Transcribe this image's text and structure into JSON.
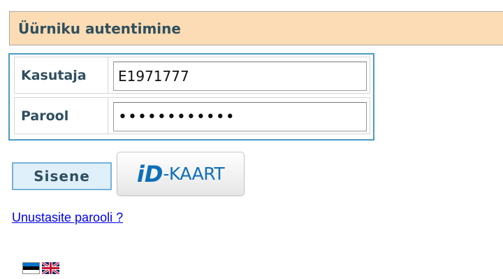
{
  "header": {
    "title": "Üürniku autentimine"
  },
  "form": {
    "username_label": "Kasutaja",
    "username_value": "E1971777",
    "password_label": "Parool",
    "password_value": "••••••••••••"
  },
  "actions": {
    "submit_label": "Sisene",
    "idcard_logo_mark": "iD",
    "idcard_label": "-KAART",
    "forgot_password_link": "Unustasite parooli ?"
  },
  "languages": [
    {
      "icon": "estonian-flag-icon",
      "colors": [
        "#0072ce",
        "#000000",
        "#ffffff"
      ]
    },
    {
      "icon": "uk-flag-icon",
      "colors": [
        "#012169",
        "#ffffff",
        "#c8102e"
      ]
    }
  ],
  "colors": {
    "header_bg": "#fcdcb4",
    "box_border": "#4a9ac6",
    "label_text": "#2f4f5f",
    "link": "#0000ee",
    "idcard_blue": "#0e6fb8"
  }
}
